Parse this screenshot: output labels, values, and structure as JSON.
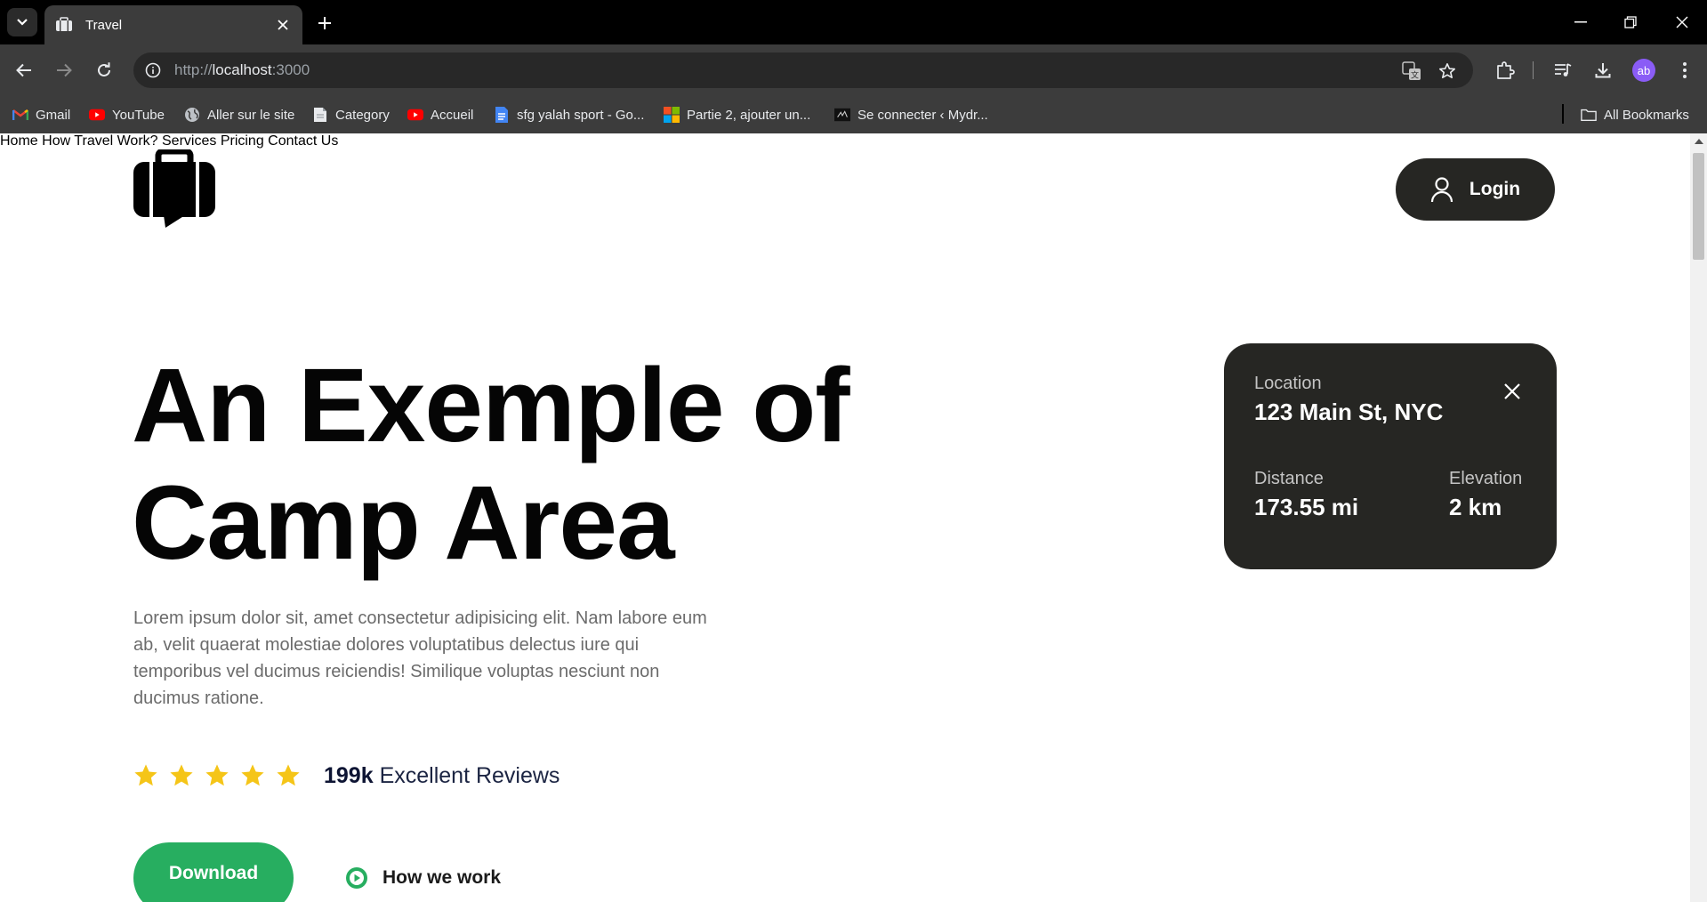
{
  "browser": {
    "tab_title": "Travel",
    "url_prefix": "http://",
    "url_host": "localhost",
    "url_port": ":3000",
    "avatar_initials": "ab",
    "bookmarks": [
      {
        "label": "Gmail",
        "icon": "gmail-icon"
      },
      {
        "label": "YouTube",
        "icon": "youtube-icon"
      },
      {
        "label": "Aller sur le site",
        "icon": "globe-icon"
      },
      {
        "label": "Category",
        "icon": "document-icon"
      },
      {
        "label": "Accueil",
        "icon": "youtube-icon"
      },
      {
        "label": "sfg yalah sport - Go...",
        "icon": "google-docs-icon"
      },
      {
        "label": "Partie 2, ajouter un...",
        "icon": "microsoft-icon"
      },
      {
        "label": "Se connecter ‹ Mydr...",
        "icon": "site-icon"
      }
    ],
    "all_bookmarks_label": "All Bookmarks"
  },
  "site": {
    "nav": [
      "Home",
      "How Travel Work?",
      "Services",
      "Pricing",
      "Contact Us"
    ],
    "login_label": "Login",
    "hero_title_line1": "An Exemple of",
    "hero_title_line2": "Camp Area",
    "hero_text": "Lorem ipsum dolor sit, amet consectetur adipisicing elit. Nam labore eum ab, velit quaerat molestiae dolores voluptatibus delectus iure qui temporibus vel ducimus reiciendis! Similique voluptas nesciunt non ducimus ratione.",
    "rating_stars": 5,
    "reviews_count": "199k",
    "reviews_label": "Excellent Reviews",
    "download_label": "Download",
    "how_we_work_label": "How we work"
  },
  "info_card": {
    "location_label": "Location",
    "location_value": "123 Main St, NYC",
    "distance_label": "Distance",
    "distance_value": "173.55 mi",
    "elevation_label": "Elevation",
    "elevation_value": "2 km"
  },
  "colors": {
    "accent_green": "#27ae60",
    "dark_card": "#262623",
    "star": "#f5c518"
  }
}
